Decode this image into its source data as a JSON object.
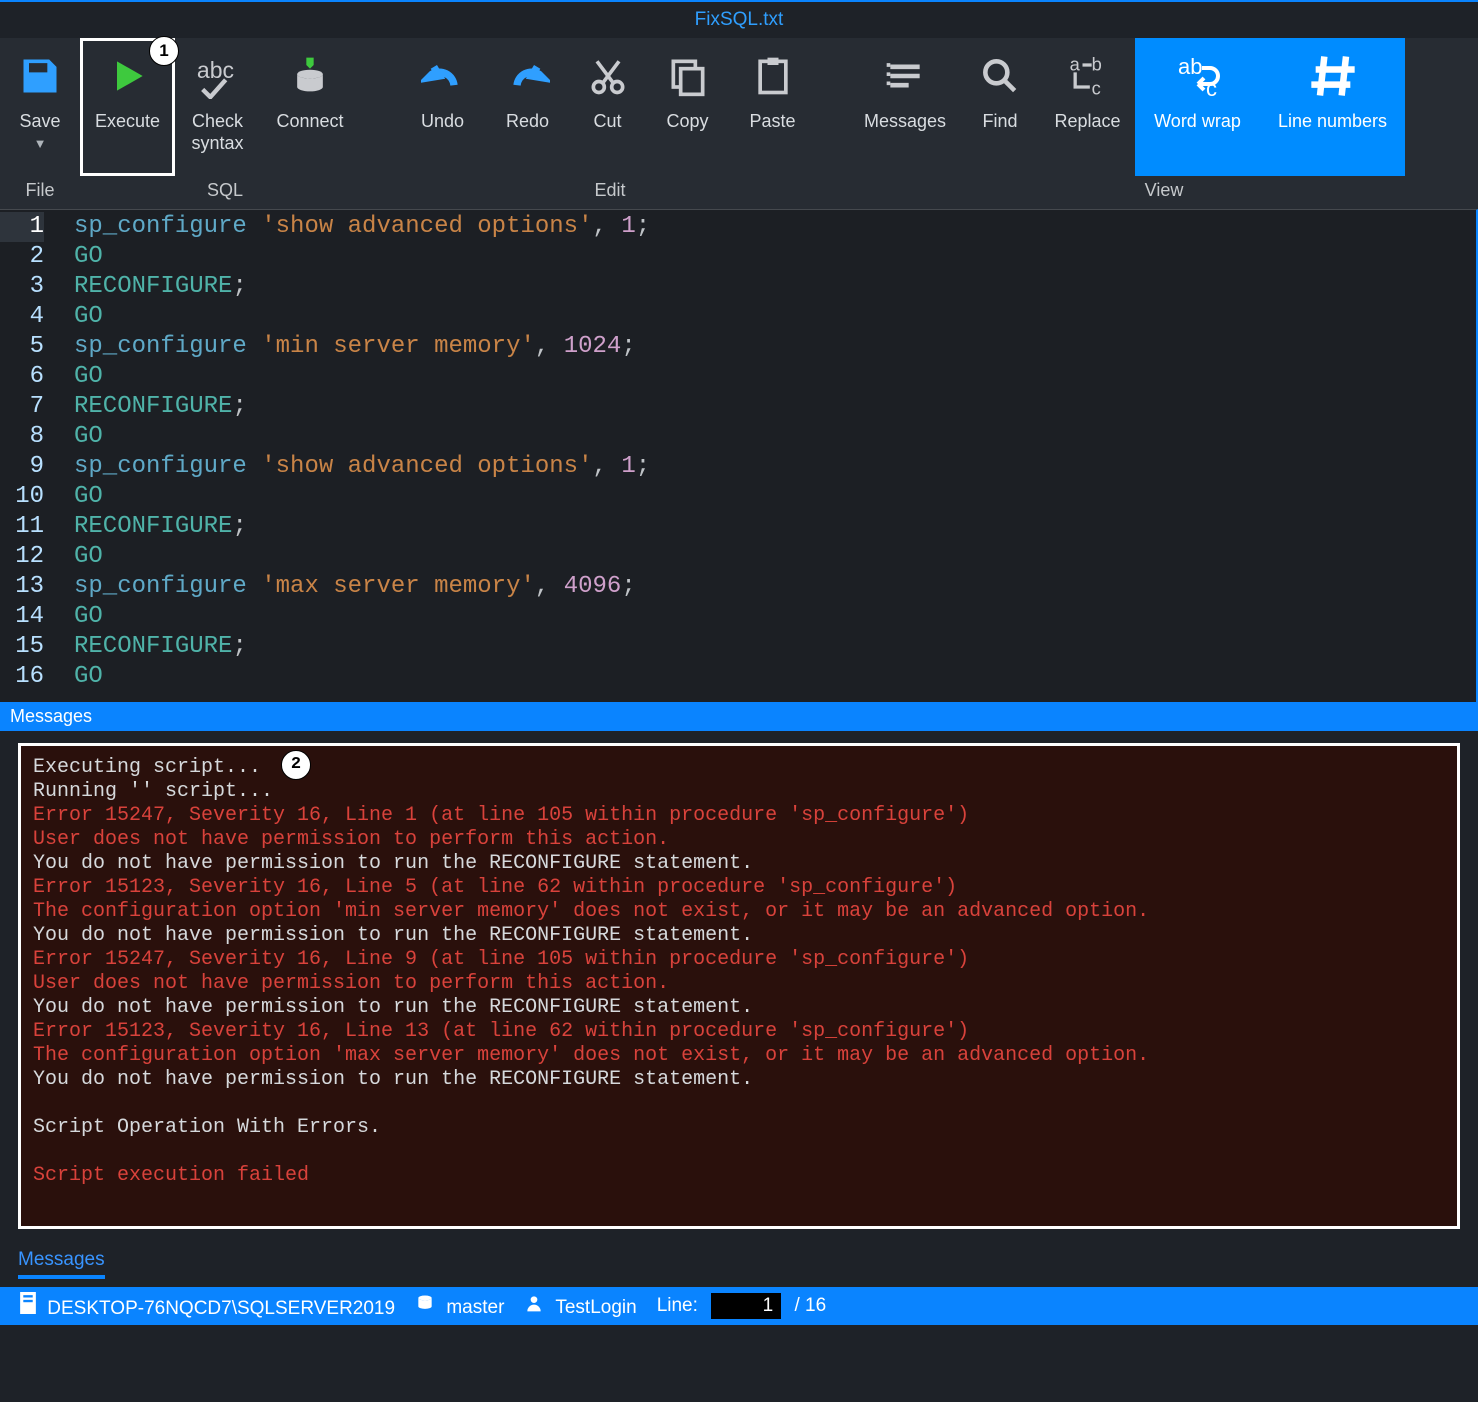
{
  "title": "FixSQL.txt",
  "ribbon": {
    "file_label": "File",
    "sql_label": "SQL",
    "edit_label": "Edit",
    "view_label": "View",
    "save": "Save",
    "execute": "Execute",
    "check": "Check\nsyntax",
    "connect": "Connect",
    "undo": "Undo",
    "redo": "Redo",
    "cut": "Cut",
    "copy": "Copy",
    "paste": "Paste",
    "messages": "Messages",
    "find": "Find",
    "replace": "Replace",
    "wordwrap": "Word wrap",
    "linenumbers": "Line numbers"
  },
  "callouts": {
    "execute": "1",
    "messages": "2"
  },
  "code": [
    [
      {
        "t": "sp",
        "v": "sp_configure"
      },
      {
        "t": "punc",
        "v": " "
      },
      {
        "t": "str",
        "v": "'show advanced options'"
      },
      {
        "t": "punc",
        "v": ", "
      },
      {
        "t": "num",
        "v": "1"
      },
      {
        "t": "punc",
        "v": ";"
      }
    ],
    [
      {
        "t": "kw",
        "v": "GO"
      }
    ],
    [
      {
        "t": "kw",
        "v": "RECONFIGURE"
      },
      {
        "t": "punc",
        "v": ";"
      }
    ],
    [
      {
        "t": "kw",
        "v": "GO"
      }
    ],
    [
      {
        "t": "sp",
        "v": "sp_configure"
      },
      {
        "t": "punc",
        "v": " "
      },
      {
        "t": "str",
        "v": "'min server memory'"
      },
      {
        "t": "punc",
        "v": ", "
      },
      {
        "t": "num",
        "v": "1024"
      },
      {
        "t": "punc",
        "v": ";"
      }
    ],
    [
      {
        "t": "kw",
        "v": "GO"
      }
    ],
    [
      {
        "t": "kw",
        "v": "RECONFIGURE"
      },
      {
        "t": "punc",
        "v": ";"
      }
    ],
    [
      {
        "t": "kw",
        "v": "GO"
      }
    ],
    [
      {
        "t": "sp",
        "v": "sp_configure"
      },
      {
        "t": "punc",
        "v": " "
      },
      {
        "t": "str",
        "v": "'show advanced options'"
      },
      {
        "t": "punc",
        "v": ", "
      },
      {
        "t": "num",
        "v": "1"
      },
      {
        "t": "punc",
        "v": ";"
      }
    ],
    [
      {
        "t": "kw",
        "v": "GO"
      }
    ],
    [
      {
        "t": "kw",
        "v": "RECONFIGURE"
      },
      {
        "t": "punc",
        "v": ";"
      }
    ],
    [
      {
        "t": "kw",
        "v": "GO"
      }
    ],
    [
      {
        "t": "sp",
        "v": "sp_configure"
      },
      {
        "t": "punc",
        "v": " "
      },
      {
        "t": "str",
        "v": "'max server memory'"
      },
      {
        "t": "punc",
        "v": ", "
      },
      {
        "t": "num",
        "v": "4096"
      },
      {
        "t": "punc",
        "v": ";"
      }
    ],
    [
      {
        "t": "kw",
        "v": "GO"
      }
    ],
    [
      {
        "t": "kw",
        "v": "RECONFIGURE"
      },
      {
        "t": "punc",
        "v": ";"
      }
    ],
    [
      {
        "t": "kw",
        "v": "GO"
      }
    ]
  ],
  "messages_header": "Messages",
  "messages_tab": "Messages",
  "messages": [
    {
      "cls": "ok",
      "text": "Executing script..."
    },
    {
      "cls": "ok",
      "text": "Running '' script..."
    },
    {
      "cls": "err",
      "text": "Error 15247, Severity 16, Line 1 (at line 105 within procedure 'sp_configure')"
    },
    {
      "cls": "err",
      "text": "User does not have permission to perform this action."
    },
    {
      "cls": "ok",
      "text": "You do not have permission to run the RECONFIGURE statement."
    },
    {
      "cls": "err",
      "text": "Error 15123, Severity 16, Line 5 (at line 62 within procedure 'sp_configure')"
    },
    {
      "cls": "err",
      "text": "The configuration option 'min server memory' does not exist, or it may be an advanced option."
    },
    {
      "cls": "ok",
      "text": "You do not have permission to run the RECONFIGURE statement."
    },
    {
      "cls": "err",
      "text": "Error 15247, Severity 16, Line 9 (at line 105 within procedure 'sp_configure')"
    },
    {
      "cls": "err",
      "text": "User does not have permission to perform this action."
    },
    {
      "cls": "ok",
      "text": "You do not have permission to run the RECONFIGURE statement."
    },
    {
      "cls": "err",
      "text": "Error 15123, Severity 16, Line 13 (at line 62 within procedure 'sp_configure')"
    },
    {
      "cls": "err",
      "text": "The configuration option 'max server memory' does not exist, or it may be an advanced option."
    },
    {
      "cls": "ok",
      "text": "You do not have permission to run the RECONFIGURE statement."
    },
    {
      "cls": "ok",
      "text": ""
    },
    {
      "cls": "ok",
      "text": "Script Operation With Errors."
    },
    {
      "cls": "ok",
      "text": ""
    },
    {
      "cls": "err",
      "text": "Script execution failed"
    }
  ],
  "statusbar": {
    "server": "DESKTOP-76NQCD7\\SQLSERVER2019",
    "database": "master",
    "user": "TestLogin",
    "line_label": "Line:",
    "line_current": "1",
    "line_total": "/ 16"
  }
}
